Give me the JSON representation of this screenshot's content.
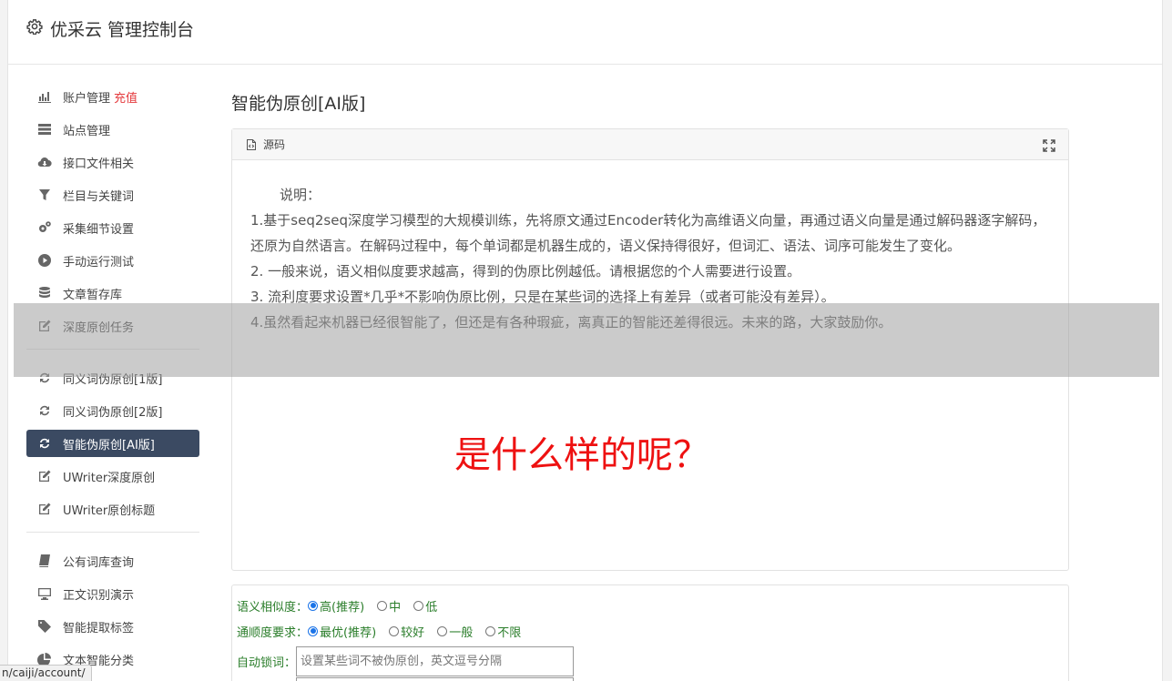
{
  "header": {
    "title": "优采云 管理控制台",
    "icon": "gear-icon"
  },
  "sidebar": {
    "group1": [
      {
        "label": "账户管理",
        "badge": "充值",
        "icon": "bar-chart-icon"
      },
      {
        "label": "站点管理",
        "icon": "server-icon"
      },
      {
        "label": "接口文件相关",
        "icon": "cloud-download-icon"
      },
      {
        "label": "栏目与关键词",
        "icon": "filter-icon"
      },
      {
        "label": "采集细节设置",
        "icon": "gears-icon"
      },
      {
        "label": "手动运行测试",
        "icon": "play-circle-icon"
      },
      {
        "label": "文章暂存库",
        "icon": "database-icon"
      },
      {
        "label": "深度原创任务",
        "icon": "edit-icon"
      }
    ],
    "group2": [
      {
        "label": "同义词伪原创[1版]",
        "icon": "refresh-icon"
      },
      {
        "label": "同义词伪原创[2版]",
        "icon": "refresh-icon"
      },
      {
        "label": "智能伪原创[AI版]",
        "icon": "refresh-icon",
        "active": true
      },
      {
        "label": "UWriter深度原创",
        "icon": "edit-icon"
      },
      {
        "label": "UWriter原创标题",
        "icon": "edit-icon"
      }
    ],
    "group3": [
      {
        "label": "公有词库查询",
        "icon": "book-icon"
      },
      {
        "label": "正文识别演示",
        "icon": "monitor-icon"
      },
      {
        "label": "智能提取标签",
        "icon": "tag-icon"
      },
      {
        "label": "文本智能分类",
        "icon": "pie-chart-icon"
      }
    ]
  },
  "main": {
    "title": "智能伪原创[AI版]",
    "panel": {
      "tab_label": "源码",
      "lines": [
        "说明：",
        "1.基于seq2seq深度学习模型的大规模训练，先将原文通过Encoder转化为高维语义向量，再通过语义向量是通过解码器逐字解码，还原为自然语言。在解码过程中，每个单词都是机器生成的，语义保持得很好，但词汇、语法、词序可能发生了变化。",
        "2. 一般来说，语义相似度要求越高，得到的伪原比例越低。请根据您的个人需要进行设置。",
        "3. 流利度要求设置*几乎*不影响伪原比例，只是在某些词的选择上有差异（或者可能没有差异）。",
        "4.虽然看起来机器已经很智能了，但还是有各种瑕疵，离真正的智能还差得很远。未来的路，大家鼓励你。"
      ],
      "overlay_question": "是什么样的呢？"
    },
    "form": {
      "similarity": {
        "label": "语义相似度：",
        "options": [
          "高(推荐)",
          "中",
          "低"
        ],
        "selected": 0
      },
      "fluency": {
        "label": "通顺度要求：",
        "options": [
          "最优(推荐)",
          "较好",
          "一般",
          "不限"
        ],
        "selected": 0
      },
      "lock": {
        "label": "自动锁词：",
        "placeholder": "设置某些词不被伪原创，英文逗号分隔"
      }
    }
  },
  "status_bar": {
    "url": "n/caiji/account/"
  },
  "colors": {
    "accent": "#3b4a62",
    "question": "#ee1111",
    "form_label": "#2a7d2a",
    "badge": "#e4393c"
  }
}
